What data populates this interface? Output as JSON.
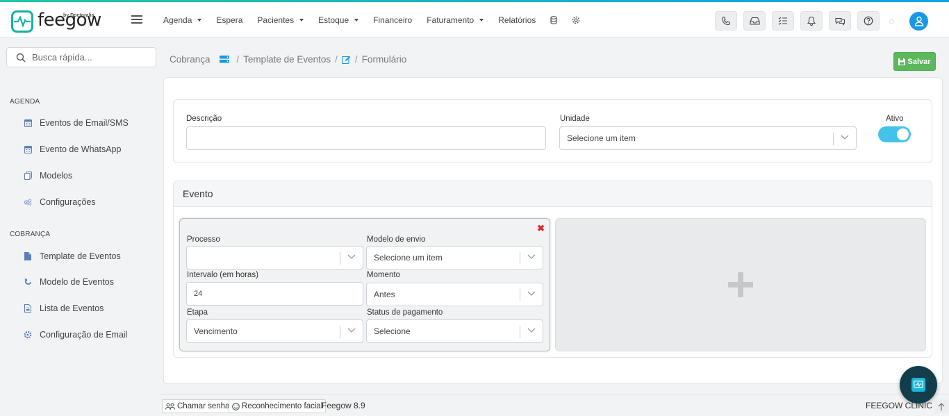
{
  "brand": {
    "name": "feegow",
    "sub": "by Doctoralia"
  },
  "nav": {
    "items": [
      {
        "label": "Agenda",
        "dropdown": true
      },
      {
        "label": "Espera",
        "dropdown": false
      },
      {
        "label": "Pacientes",
        "dropdown": true
      },
      {
        "label": "Estoque",
        "dropdown": true
      },
      {
        "label": "Financeiro",
        "dropdown": false
      },
      {
        "label": "Faturamento",
        "dropdown": true
      },
      {
        "label": "Relatórios",
        "dropdown": false
      }
    ],
    "icons": [
      "database-icon",
      "gear-icon"
    ],
    "toolbar_icons": [
      "phone-icon",
      "inbox-icon",
      "checklist-icon",
      "bell-icon",
      "chat-icon",
      "help-icon"
    ]
  },
  "search": {
    "placeholder": "Busca rápida..."
  },
  "sidebar": {
    "sections": [
      {
        "title": "AGENDA",
        "items": [
          {
            "label": "Eventos de Email/SMS",
            "icon": "calendar-icon"
          },
          {
            "label": "Evento de WhatsApp",
            "icon": "calendar-icon"
          },
          {
            "label": "Modelos",
            "icon": "copy-icon"
          },
          {
            "label": "Configurações",
            "icon": "cogs-icon"
          }
        ]
      },
      {
        "title": "COBRANÇA",
        "items": [
          {
            "label": "Template de Eventos",
            "icon": "file-icon"
          },
          {
            "label": "Modelo de Eventos",
            "icon": "refresh-icon"
          },
          {
            "label": "Lista de Eventos",
            "icon": "file-text-icon"
          },
          {
            "label": "Configuração de Email",
            "icon": "cog-icon"
          }
        ]
      }
    ]
  },
  "breadcrumb": {
    "items": [
      "Cobrança",
      "Template de Eventos",
      "Formulário"
    ]
  },
  "actions": {
    "save": "Salvar"
  },
  "form": {
    "descricao_label": "Descrição",
    "descricao_value": "",
    "unidade_label": "Unidade",
    "unidade_value": "Selecione um item",
    "ativo_label": "Ativo",
    "ativo_value": true
  },
  "evento": {
    "title": "Evento",
    "fields": {
      "processo_label": "Processo",
      "processo_value": "",
      "modelo_label": "Modelo de envio",
      "modelo_value": "Selecione um item",
      "intervalo_label": "Intervalo (em horas)",
      "intervalo_value": "24",
      "momento_label": "Momento",
      "momento_value": "Antes",
      "etapa_label": "Etapa",
      "etapa_value": "Vencimento",
      "status_label": "Status de pagamento",
      "status_value": "Selecione"
    },
    "remove_symbol": "✖"
  },
  "footer": {
    "chamar_senha": "Chamar senha",
    "reconhecimento": "Reconhecimento facial",
    "version": "Feegow 8.9",
    "clinic": "FEEGOW CLINIC"
  },
  "colors": {
    "accent": "#1a97e8",
    "toggle": "#44c3ea",
    "save": "#5cb85c",
    "brand": "#14b3a4"
  }
}
